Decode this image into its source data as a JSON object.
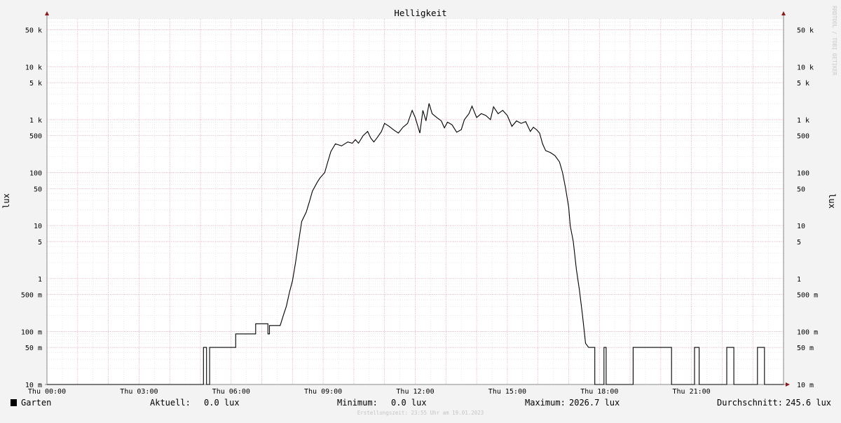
{
  "chart_data": {
    "type": "line",
    "title": "Helligkeit",
    "ylabel": "lux",
    "ylabel_right": "lux",
    "yscale": "log",
    "ylim": [
      0.01,
      80000
    ],
    "xlim": [
      0,
      24
    ],
    "x_unit": "hours",
    "y_ticks": [
      {
        "value": 0.01,
        "label": "10 m"
      },
      {
        "value": 0.05,
        "label": "50 m"
      },
      {
        "value": 0.1,
        "label": "100 m"
      },
      {
        "value": 0.5,
        "label": "500 m"
      },
      {
        "value": 1,
        "label": "1"
      },
      {
        "value": 5,
        "label": "5"
      },
      {
        "value": 10,
        "label": "10"
      },
      {
        "value": 50,
        "label": "50"
      },
      {
        "value": 100,
        "label": "100"
      },
      {
        "value": 500,
        "label": "500"
      },
      {
        "value": 1000,
        "label": "1 k"
      },
      {
        "value": 5000,
        "label": "5 k"
      },
      {
        "value": 10000,
        "label": "10 k"
      },
      {
        "value": 50000,
        "label": "50 k"
      }
    ],
    "x_ticks": [
      {
        "value": 0,
        "label": "Thu 00:00"
      },
      {
        "value": 3,
        "label": "Thu 03:00"
      },
      {
        "value": 6,
        "label": "Thu 06:00"
      },
      {
        "value": 9,
        "label": "Thu 09:00"
      },
      {
        "value": 12,
        "label": "Thu 12:00"
      },
      {
        "value": 15,
        "label": "Thu 15:00"
      },
      {
        "value": 18,
        "label": "Thu 18:00"
      },
      {
        "value": 21,
        "label": "Thu 21:00"
      }
    ],
    "grid": true,
    "legend_position": "bottom-left",
    "series": [
      {
        "name": "Garten",
        "color": "#000000",
        "points": [
          [
            0,
            0.01
          ],
          [
            5.1,
            0.01
          ],
          [
            5.1,
            0.05
          ],
          [
            5.2,
            0.05
          ],
          [
            5.2,
            0.01
          ],
          [
            5.3,
            0.01
          ],
          [
            5.3,
            0.05
          ],
          [
            6.15,
            0.05
          ],
          [
            6.15,
            0.09
          ],
          [
            6.8,
            0.09
          ],
          [
            6.8,
            0.14
          ],
          [
            7.2,
            0.14
          ],
          [
            7.2,
            0.09
          ],
          [
            7.25,
            0.09
          ],
          [
            7.25,
            0.13
          ],
          [
            7.6,
            0.13
          ],
          [
            7.7,
            0.2
          ],
          [
            7.8,
            0.3
          ],
          [
            7.9,
            0.55
          ],
          [
            8.0,
            0.9
          ],
          [
            8.1,
            2
          ],
          [
            8.2,
            5
          ],
          [
            8.3,
            12
          ],
          [
            8.45,
            18
          ],
          [
            8.55,
            28
          ],
          [
            8.65,
            45
          ],
          [
            8.8,
            65
          ],
          [
            8.9,
            80
          ],
          [
            9.05,
            100
          ],
          [
            9.15,
            160
          ],
          [
            9.25,
            250
          ],
          [
            9.4,
            350
          ],
          [
            9.6,
            320
          ],
          [
            9.8,
            380
          ],
          [
            9.95,
            360
          ],
          [
            10.05,
            420
          ],
          [
            10.15,
            360
          ],
          [
            10.3,
            500
          ],
          [
            10.45,
            600
          ],
          [
            10.55,
            450
          ],
          [
            10.65,
            380
          ],
          [
            10.75,
            450
          ],
          [
            10.9,
            600
          ],
          [
            11.0,
            850
          ],
          [
            11.15,
            750
          ],
          [
            11.3,
            640
          ],
          [
            11.45,
            560
          ],
          [
            11.6,
            720
          ],
          [
            11.75,
            850
          ],
          [
            11.9,
            1500
          ],
          [
            12.0,
            1100
          ],
          [
            12.15,
            560
          ],
          [
            12.25,
            1500
          ],
          [
            12.35,
            950
          ],
          [
            12.45,
            2026.7
          ],
          [
            12.55,
            1300
          ],
          [
            12.7,
            1100
          ],
          [
            12.85,
            950
          ],
          [
            12.95,
            700
          ],
          [
            13.05,
            900
          ],
          [
            13.2,
            800
          ],
          [
            13.35,
            580
          ],
          [
            13.5,
            650
          ],
          [
            13.6,
            1000
          ],
          [
            13.75,
            1300
          ],
          [
            13.85,
            1800
          ],
          [
            14.0,
            1100
          ],
          [
            14.15,
            1300
          ],
          [
            14.3,
            1200
          ],
          [
            14.45,
            1000
          ],
          [
            14.55,
            1750
          ],
          [
            14.7,
            1300
          ],
          [
            14.85,
            1500
          ],
          [
            15.0,
            1200
          ],
          [
            15.15,
            750
          ],
          [
            15.3,
            950
          ],
          [
            15.45,
            850
          ],
          [
            15.6,
            920
          ],
          [
            15.75,
            600
          ],
          [
            15.85,
            720
          ],
          [
            15.95,
            650
          ],
          [
            16.05,
            560
          ],
          [
            16.15,
            350
          ],
          [
            16.25,
            260
          ],
          [
            16.4,
            240
          ],
          [
            16.55,
            210
          ],
          [
            16.7,
            160
          ],
          [
            16.8,
            100
          ],
          [
            16.9,
            50
          ],
          [
            17.0,
            22
          ],
          [
            17.05,
            10
          ],
          [
            17.15,
            5
          ],
          [
            17.25,
            1.5
          ],
          [
            17.35,
            0.6
          ],
          [
            17.45,
            0.2
          ],
          [
            17.55,
            0.06
          ],
          [
            17.65,
            0.05
          ],
          [
            17.85,
            0.05
          ],
          [
            17.85,
            0.01
          ],
          [
            18.15,
            0.01
          ],
          [
            18.15,
            0.05
          ],
          [
            18.22,
            0.05
          ],
          [
            18.22,
            0.01
          ],
          [
            19.1,
            0.01
          ],
          [
            19.1,
            0.05
          ],
          [
            20.35,
            0.05
          ],
          [
            20.35,
            0.01
          ],
          [
            21.1,
            0.01
          ],
          [
            21.1,
            0.05
          ],
          [
            21.25,
            0.05
          ],
          [
            21.25,
            0.01
          ],
          [
            22.15,
            0.01
          ],
          [
            22.15,
            0.05
          ],
          [
            22.38,
            0.05
          ],
          [
            22.38,
            0.01
          ],
          [
            23.15,
            0.01
          ],
          [
            23.15,
            0.05
          ],
          [
            23.38,
            0.05
          ],
          [
            23.38,
            0.01
          ],
          [
            24,
            0.01
          ]
        ]
      }
    ],
    "legend": {
      "series_name": "Garten",
      "aktuell_label": "Aktuell:",
      "aktuell_value": "0.0 lux",
      "minimum_label": "Minimum:",
      "minimum_value": "0.0 lux",
      "maximum_label": "Maximum:",
      "maximum_value": "2026.7 lux",
      "avg_label": "Durchschnitt:",
      "avg_value": "245.6 lux"
    },
    "footer": "Erstellungszeit: 23:55 Uhr am 19.01.2023",
    "watermark": "RRDTOOL / TOBI OETIKER"
  }
}
